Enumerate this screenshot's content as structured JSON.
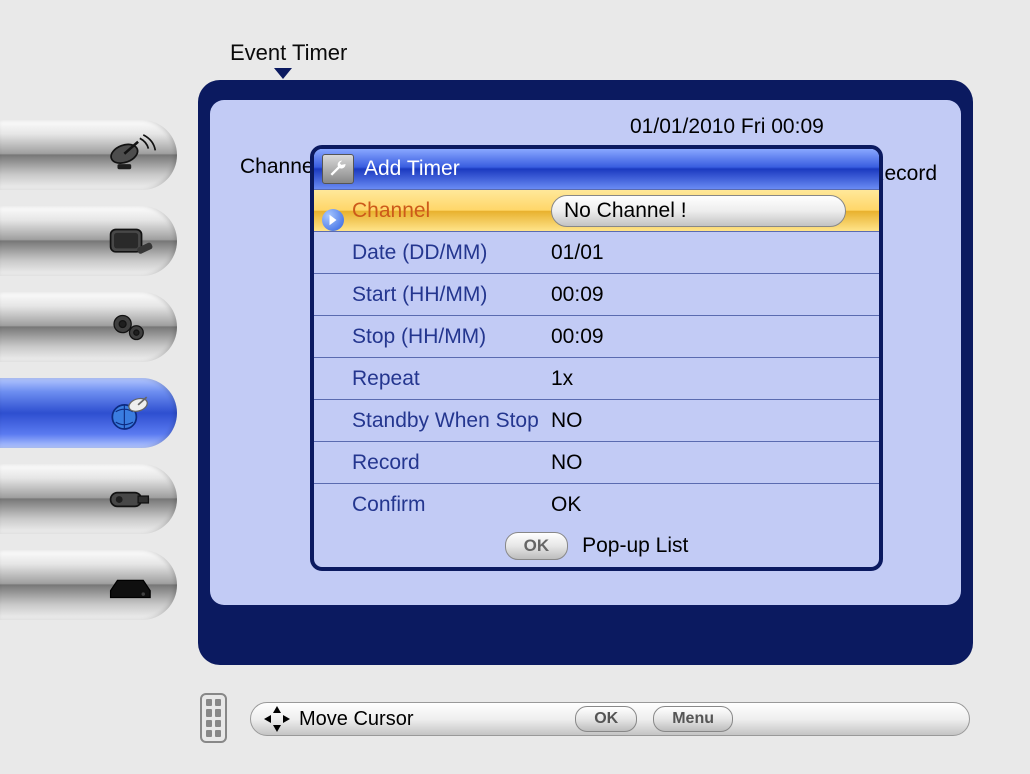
{
  "title": "Event Timer",
  "datetime": "01/01/2010   Fri   00:09",
  "background": {
    "left_label": "Channe",
    "right_label": "Record"
  },
  "dialog": {
    "title": "Add Timer",
    "fields": [
      {
        "label": "Channel",
        "value": "No Channel !",
        "selected": true,
        "pill": true
      },
      {
        "label": "Date (DD/MM)",
        "value": "01/01"
      },
      {
        "label": "Start (HH/MM)",
        "value": "00:09"
      },
      {
        "label": "Stop (HH/MM)",
        "value": "00:09"
      },
      {
        "label": "Repeat",
        "value": "1x"
      },
      {
        "label": "Standby When Stop",
        "value": "NO"
      },
      {
        "label": "Record",
        "value": "NO"
      },
      {
        "label": "Confirm",
        "value": "OK"
      }
    ],
    "help_button": "OK",
    "help_label": "Pop-up List"
  },
  "footer": {
    "move": "Move Cursor",
    "ok": "OK",
    "menu": "Menu"
  },
  "sidebar_icons": [
    "dish",
    "tv",
    "gear",
    "globe-dish",
    "usb",
    "stb"
  ]
}
